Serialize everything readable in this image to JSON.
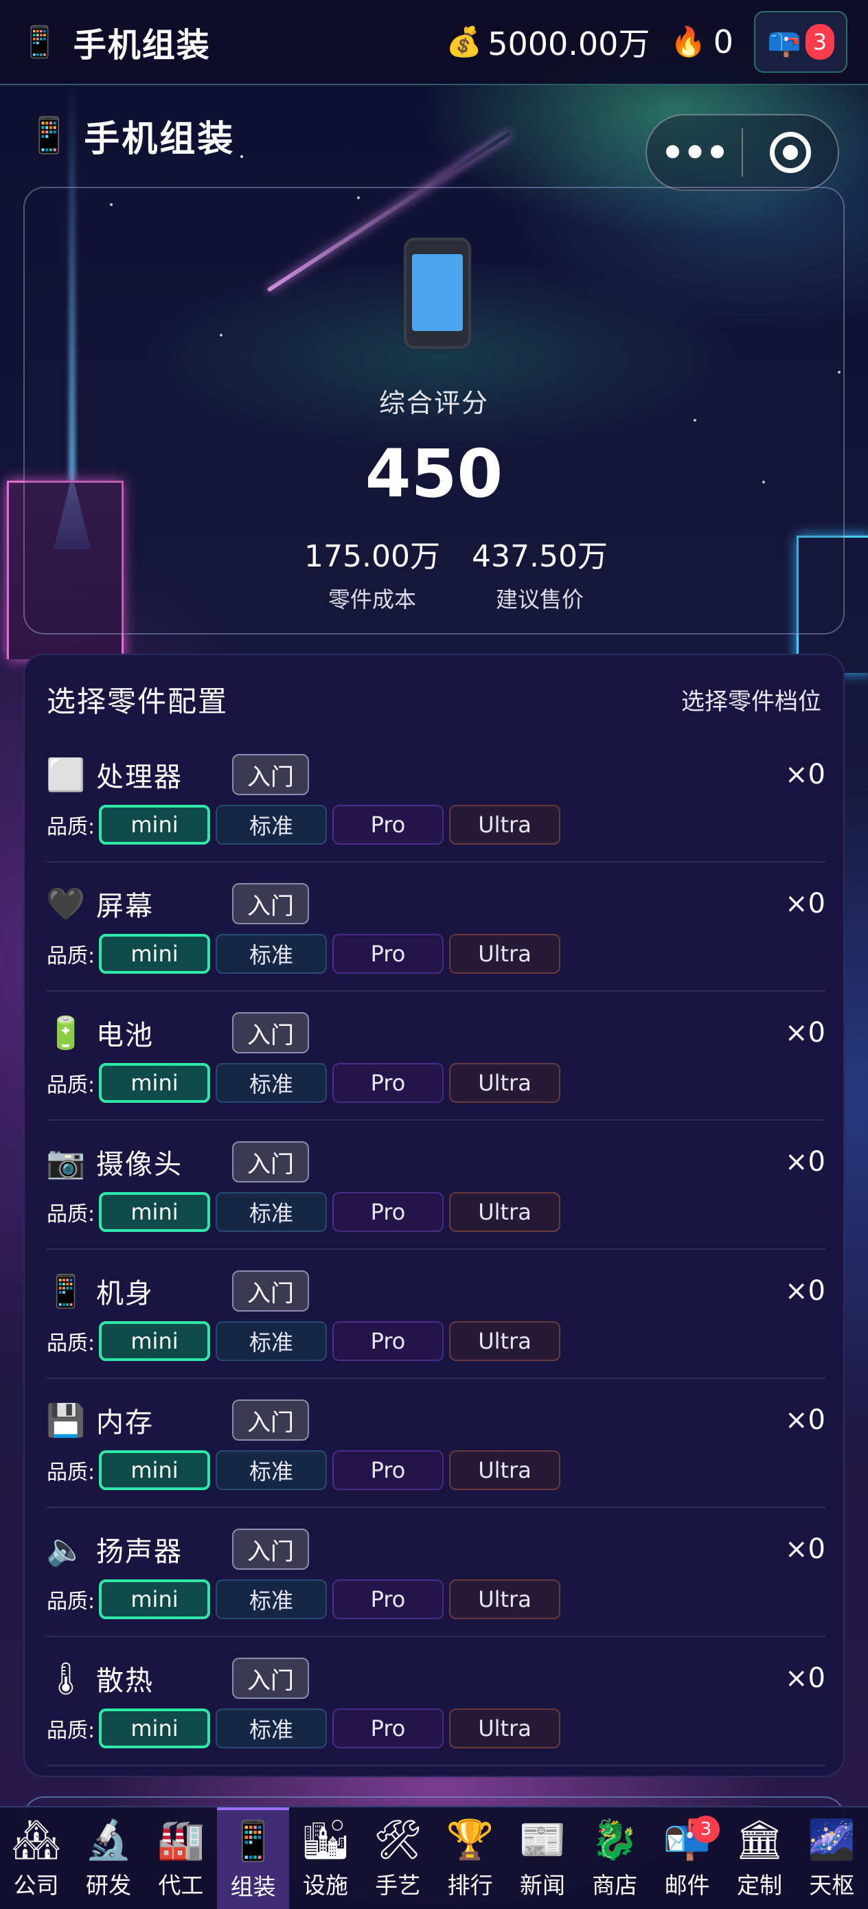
{
  "topbar": {
    "app_icon": "📱",
    "title": "手机组装",
    "money_icon": "💰",
    "money": "5000.00万",
    "fire_icon": "🔥",
    "fire": "0",
    "mail_icon": "📪",
    "mail_badge": "3"
  },
  "page": {
    "icon": "📱",
    "title": "手机组装",
    "capsule_menu": "•••"
  },
  "score": {
    "label": "综合评分",
    "value": "450",
    "cost_value": "175.00万",
    "cost_label": "零件成本",
    "price_value": "437.50万",
    "price_label": "建议售价"
  },
  "parts_panel": {
    "title": "选择零件配置",
    "right_label": "选择零件档位",
    "quality_label": "品质:",
    "quality_options": [
      "mini",
      "标准",
      "Pro",
      "Ultra"
    ],
    "selected_quality": "mini",
    "parts": [
      {
        "icon": "⬜",
        "name": "处理器",
        "tier": "入门",
        "count": "×0"
      },
      {
        "icon": "🖤",
        "name": "屏幕",
        "tier": "入门",
        "count": "×0"
      },
      {
        "icon": "🔋",
        "name": "电池",
        "tier": "入门",
        "count": "×0"
      },
      {
        "icon": "📷",
        "name": "摄像头",
        "tier": "入门",
        "count": "×0"
      },
      {
        "icon": "📱",
        "name": "机身",
        "tier": "入门",
        "count": "×0"
      },
      {
        "icon": "💾",
        "name": "内存",
        "tier": "入门",
        "count": "×0"
      },
      {
        "icon": "🔈",
        "name": "扬声器",
        "tier": "入门",
        "count": "×0"
      },
      {
        "icon": "🌡",
        "name": "散热",
        "tier": "入门",
        "count": "×0"
      }
    ]
  },
  "nav": {
    "active": "组装",
    "items": [
      {
        "icon": "🏘",
        "label": "公司"
      },
      {
        "icon": "🔬",
        "label": "研发"
      },
      {
        "icon": "🏭",
        "label": "代工"
      },
      {
        "icon": "📱",
        "label": "组装"
      },
      {
        "icon": "🏙",
        "label": "设施"
      },
      {
        "icon": "🛠",
        "label": "手艺"
      },
      {
        "icon": "🏆",
        "label": "排行"
      },
      {
        "icon": "📰",
        "label": "新闻"
      },
      {
        "icon": "🐉",
        "label": "商店"
      },
      {
        "icon": "📬",
        "label": "邮件",
        "badge": "3"
      },
      {
        "icon": "🏛",
        "label": "定制"
      },
      {
        "icon": "🌌",
        "label": "天枢"
      }
    ]
  }
}
